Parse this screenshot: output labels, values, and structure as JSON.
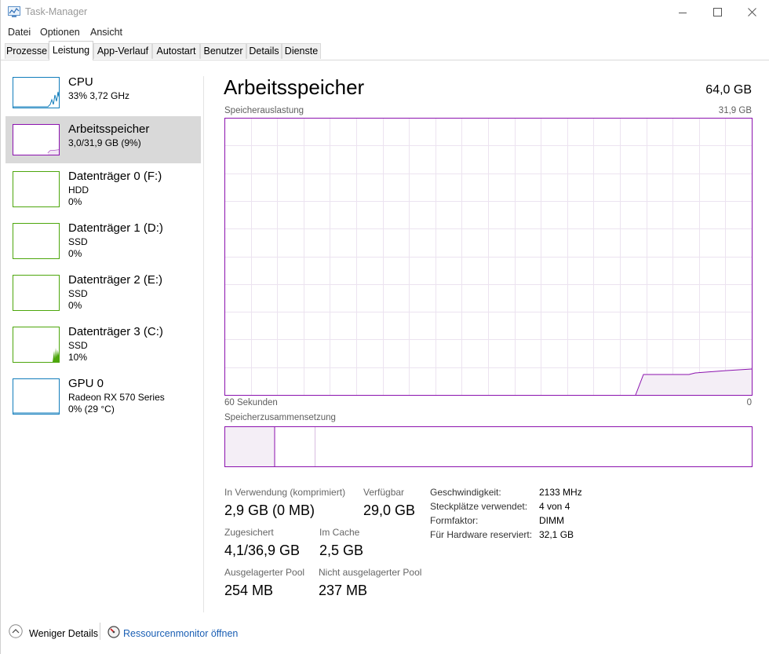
{
  "window": {
    "title": "Task-Manager"
  },
  "menu": [
    "Datei",
    "Optionen",
    "Ansicht"
  ],
  "tabs": [
    "Prozesse",
    "Leistung",
    "App-Verlauf",
    "Autostart",
    "Benutzer",
    "Details",
    "Dienste"
  ],
  "active_tab": "Leistung",
  "sidebar": [
    {
      "title": "CPU",
      "lines": [
        "33% 3,72 GHz"
      ],
      "color": "#117dbb",
      "selected": false
    },
    {
      "title": "Arbeitsspeicher",
      "lines": [
        "3,0/31,9 GB (9%)"
      ],
      "color": "#8b12ae",
      "selected": true
    },
    {
      "title": "Datenträger 0 (F:)",
      "lines": [
        "HDD",
        "0%"
      ],
      "color": "#4da60c",
      "selected": false
    },
    {
      "title": "Datenträger 1 (D:)",
      "lines": [
        "SSD",
        "0%"
      ],
      "color": "#4da60c",
      "selected": false
    },
    {
      "title": "Datenträger 2 (E:)",
      "lines": [
        "SSD",
        "0%"
      ],
      "color": "#4da60c",
      "selected": false
    },
    {
      "title": "Datenträger 3 (C:)",
      "lines": [
        "SSD",
        "10%"
      ],
      "color": "#4da60c",
      "selected": false
    },
    {
      "title": "GPU 0",
      "lines": [
        "Radeon RX 570 Series",
        "0% (29 °C)"
      ],
      "color": "#117dbb",
      "selected": false
    }
  ],
  "main": {
    "title": "Arbeitsspeicher",
    "total": "64,0 GB",
    "usage_label": "Speicherauslastung",
    "usage_max": "31,9 GB",
    "time_left": "60 Sekunden",
    "time_right": "0",
    "composition_label": "Speicherzusammensetzung",
    "accent": "#8b12ae",
    "stats": {
      "in_use_label": "In Verwendung (komprimiert)",
      "in_use_value": "2,9 GB (0 MB)",
      "available_label": "Verfügbar",
      "available_value": "29,0 GB",
      "committed_label": "Zugesichert",
      "committed_value": "4,1/36,9 GB",
      "cached_label": "Im Cache",
      "cached_value": "2,5 GB",
      "paged_label": "Ausgelagerter Pool",
      "paged_value": "254 MB",
      "nonpaged_label": "Nicht ausgelagerter Pool",
      "nonpaged_value": "237 MB"
    },
    "properties": {
      "speed_label": "Geschwindigkeit:",
      "speed_value": "2133 MHz",
      "slots_label": "Steckplätze verwendet:",
      "slots_value": "4 von 4",
      "form_label": "Formfaktor:",
      "form_value": "DIMM",
      "reserved_label": "Für Hardware reserviert:",
      "reserved_value": "32,1 GB"
    }
  },
  "footer": {
    "fewer_details": "Weniger Details",
    "resource_monitor": "Ressourcenmonitor öffnen"
  }
}
